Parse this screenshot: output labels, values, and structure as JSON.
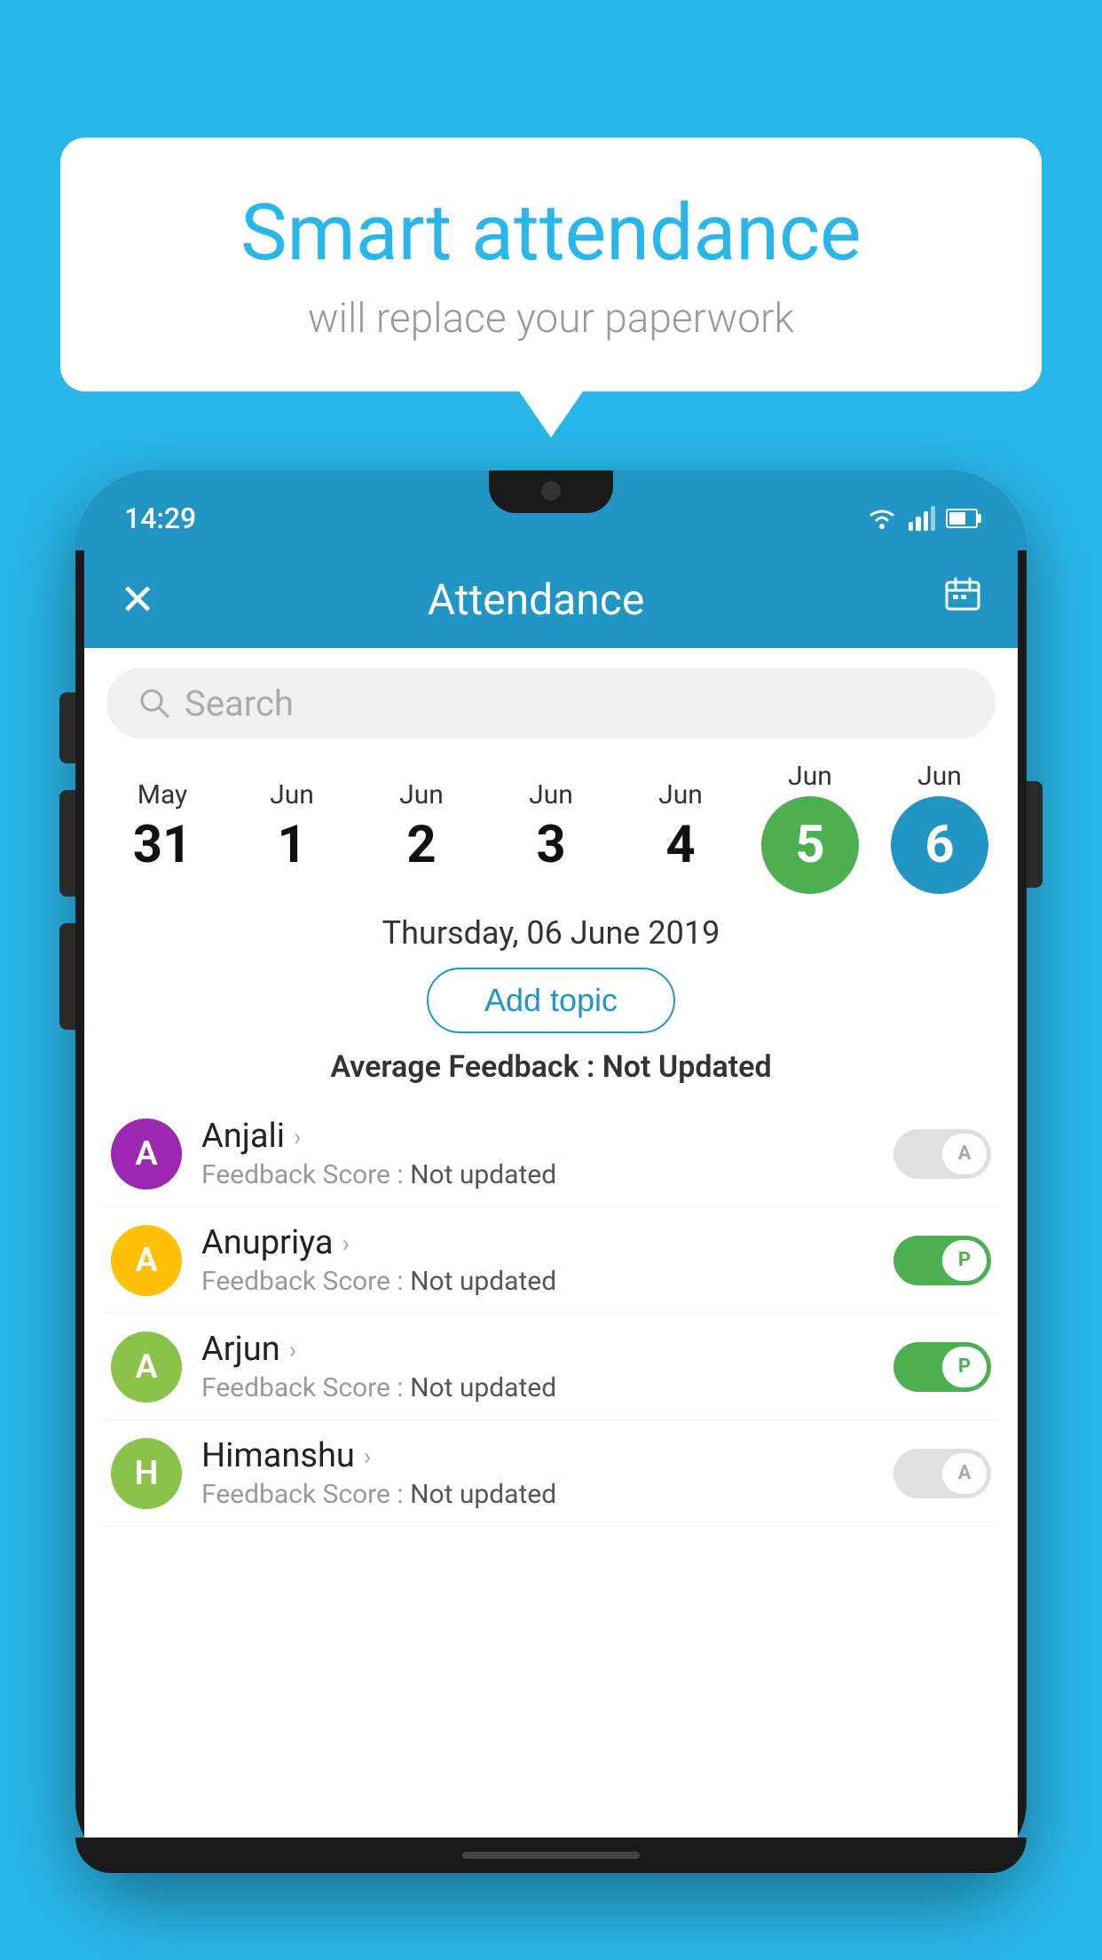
{
  "bubble": {
    "title": "Smart attendance",
    "subtitle": "will replace your paperwork"
  },
  "status_bar": {
    "time": "14:29"
  },
  "header": {
    "title": "Attendance",
    "close_label": "✕",
    "calendar_icon": "📅"
  },
  "search": {
    "placeholder": "Search"
  },
  "dates": [
    {
      "month": "May",
      "day": "31",
      "highlight": "none"
    },
    {
      "month": "Jun",
      "day": "1",
      "highlight": "none"
    },
    {
      "month": "Jun",
      "day": "2",
      "highlight": "none"
    },
    {
      "month": "Jun",
      "day": "3",
      "highlight": "none"
    },
    {
      "month": "Jun",
      "day": "4",
      "highlight": "none"
    },
    {
      "month": "Jun",
      "day": "5",
      "highlight": "green"
    },
    {
      "month": "Jun",
      "day": "6",
      "highlight": "blue"
    }
  ],
  "selected_date": "Thursday, 06 June 2019",
  "add_topic_label": "Add topic",
  "avg_feedback_label": "Average Feedback : ",
  "avg_feedback_value": "Not Updated",
  "students": [
    {
      "name": "Anjali",
      "initial": "A",
      "avatar_color": "#9C27B0",
      "feedback": "Not updated",
      "toggle": "off",
      "toggle_letter": "A"
    },
    {
      "name": "Anupriya",
      "initial": "A",
      "avatar_color": "#FFC107",
      "feedback": "Not updated",
      "toggle": "on",
      "toggle_letter": "P"
    },
    {
      "name": "Arjun",
      "initial": "A",
      "avatar_color": "#8BC34A",
      "feedback": "Not updated",
      "toggle": "on",
      "toggle_letter": "P"
    },
    {
      "name": "Himanshu",
      "initial": "H",
      "avatar_color": "#8BC34A",
      "feedback": "Not updated",
      "toggle": "off",
      "toggle_letter": "A"
    }
  ]
}
